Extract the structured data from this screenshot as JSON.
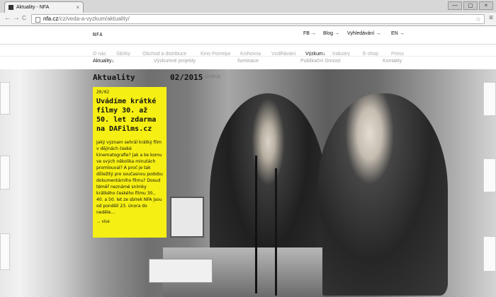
{
  "browser": {
    "tab_title": "Aktuality - NFA",
    "tab_close": "×",
    "window_buttons": [
      "—",
      "▢",
      "×"
    ],
    "url_host": "nfa.cz",
    "url_path": "/cz/veda-a-vyzkum/aktuality/",
    "star": "☆",
    "menu": "≡",
    "back": "←",
    "forward": "→",
    "reload": "C"
  },
  "site": {
    "logo": "NFA",
    "utility": [
      "FB →",
      "Blog →",
      "Vyhledávání →",
      "EN →"
    ],
    "main_nav": [
      "O nás",
      "Sbírky",
      "Obchod a distribuce",
      "Kino Ponrepo",
      "Knihovna",
      "Vzdělávání",
      "Výzkum↓",
      "Industry",
      "E-shop",
      "Press"
    ],
    "active_main": "Výzkum↓",
    "sub_nav": [
      "Aktuality↓",
      "Výzkumné projekty",
      "Iluminace",
      "Publikační činnost",
      "Kontakty"
    ],
    "active_sub": "Aktuality↓"
  },
  "hero": {
    "title": "Aktuality",
    "date": "02/2015",
    "change": "(Změnit)"
  },
  "article": {
    "date": "20/02",
    "headline": "Uvádíme krátké filmy 30. až 50. let zdarma na DAFilms.cz",
    "excerpt": "Jaký význam sehrál krátký film v dějinách české kinematografie? Jak a ke komu ve svých několika minutách promlouval? A proč je tak důležitý pro současnou podobu dokumentárního filmu? Dosud téměř neznámé snímky krátkého českého filmu 30., 40. a 50. let ze sbírek NFA jsou od pondělí 23. února do neděle…",
    "more": "→ více"
  }
}
